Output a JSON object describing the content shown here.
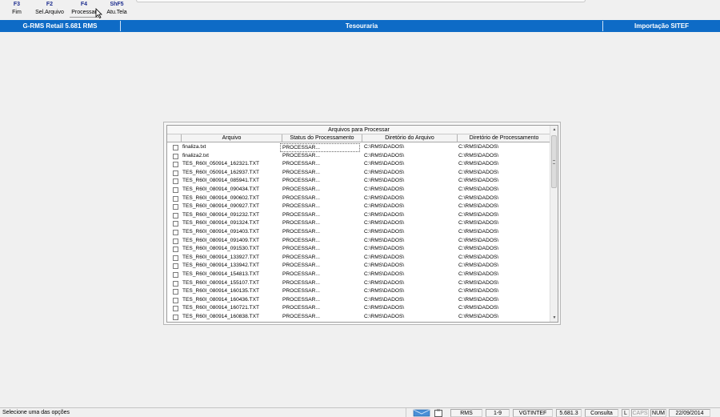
{
  "function_keys": [
    {
      "key": "F3",
      "label": "Fim"
    },
    {
      "key": "F2",
      "label": "Sel.Arquivo"
    },
    {
      "key": "F4",
      "label": "Processar"
    },
    {
      "key": "ShF5",
      "label": "Atu.Tela"
    }
  ],
  "title_bar": {
    "app": "G-RMS Retail 5.681 RMS",
    "module": "Tesouraria",
    "screen": "Importação SITEF",
    "color": "#0e6bc6"
  },
  "grid": {
    "title": "Arquivos para Processar",
    "columns": [
      "Arquivo",
      "Status do Processamento",
      "Diretório do Arquivo",
      "Diretório de Processamento"
    ],
    "rows": [
      {
        "file": "finaliza.txt",
        "status": "PROCESSAR...",
        "dir": "C:\\RMS\\DADOS\\",
        "proc_dir": "C:\\RMS\\DADOS\\"
      },
      {
        "file": "finaliza2.txt",
        "status": "PROCESSAR...",
        "dir": "C:\\RMS\\DADOS\\",
        "proc_dir": "C:\\RMS\\DADOS\\"
      },
      {
        "file": "TES_R60I_050914_162321.TXT",
        "status": "PROCESSAR...",
        "dir": "C:\\RMS\\DADOS\\",
        "proc_dir": "C:\\RMS\\DADOS\\"
      },
      {
        "file": "TES_R60I_050914_162937.TXT",
        "status": "PROCESSAR...",
        "dir": "C:\\RMS\\DADOS\\",
        "proc_dir": "C:\\RMS\\DADOS\\"
      },
      {
        "file": "TES_R60I_080914_085941.TXT",
        "status": "PROCESSAR...",
        "dir": "C:\\RMS\\DADOS\\",
        "proc_dir": "C:\\RMS\\DADOS\\"
      },
      {
        "file": "TES_R60I_080914_090434.TXT",
        "status": "PROCESSAR...",
        "dir": "C:\\RMS\\DADOS\\",
        "proc_dir": "C:\\RMS\\DADOS\\"
      },
      {
        "file": "TES_R60I_080914_090602.TXT",
        "status": "PROCESSAR...",
        "dir": "C:\\RMS\\DADOS\\",
        "proc_dir": "C:\\RMS\\DADOS\\"
      },
      {
        "file": "TES_R60I_080914_090927.TXT",
        "status": "PROCESSAR...",
        "dir": "C:\\RMS\\DADOS\\",
        "proc_dir": "C:\\RMS\\DADOS\\"
      },
      {
        "file": "TES_R60I_080914_091232.TXT",
        "status": "PROCESSAR...",
        "dir": "C:\\RMS\\DADOS\\",
        "proc_dir": "C:\\RMS\\DADOS\\"
      },
      {
        "file": "TES_R60I_080914_091324.TXT",
        "status": "PROCESSAR...",
        "dir": "C:\\RMS\\DADOS\\",
        "proc_dir": "C:\\RMS\\DADOS\\"
      },
      {
        "file": "TES_R60I_080914_091403.TXT",
        "status": "PROCESSAR...",
        "dir": "C:\\RMS\\DADOS\\",
        "proc_dir": "C:\\RMS\\DADOS\\"
      },
      {
        "file": "TES_R60I_080914_091409.TXT",
        "status": "PROCESSAR...",
        "dir": "C:\\RMS\\DADOS\\",
        "proc_dir": "C:\\RMS\\DADOS\\"
      },
      {
        "file": "TES_R60I_080914_091530.TXT",
        "status": "PROCESSAR...",
        "dir": "C:\\RMS\\DADOS\\",
        "proc_dir": "C:\\RMS\\DADOS\\"
      },
      {
        "file": "TES_R60I_080914_133927.TXT",
        "status": "PROCESSAR...",
        "dir": "C:\\RMS\\DADOS\\",
        "proc_dir": "C:\\RMS\\DADOS\\"
      },
      {
        "file": "TES_R60I_080914_133942.TXT",
        "status": "PROCESSAR...",
        "dir": "C:\\RMS\\DADOS\\",
        "proc_dir": "C:\\RMS\\DADOS\\"
      },
      {
        "file": "TES_R60I_080914_154813.TXT",
        "status": "PROCESSAR...",
        "dir": "C:\\RMS\\DADOS\\",
        "proc_dir": "C:\\RMS\\DADOS\\"
      },
      {
        "file": "TES_R60I_080914_155107.TXT",
        "status": "PROCESSAR...",
        "dir": "C:\\RMS\\DADOS\\",
        "proc_dir": "C:\\RMS\\DADOS\\"
      },
      {
        "file": "TES_R60I_080914_160135.TXT",
        "status": "PROCESSAR...",
        "dir": "C:\\RMS\\DADOS\\",
        "proc_dir": "C:\\RMS\\DADOS\\"
      },
      {
        "file": "TES_R60I_080914_160436.TXT",
        "status": "PROCESSAR...",
        "dir": "C:\\RMS\\DADOS\\",
        "proc_dir": "C:\\RMS\\DADOS\\"
      },
      {
        "file": "TES_R60I_080914_160721.TXT",
        "status": "PROCESSAR...",
        "dir": "C:\\RMS\\DADOS\\",
        "proc_dir": "C:\\RMS\\DADOS\\"
      },
      {
        "file": "TES_R60I_080914_160838.TXT",
        "status": "PROCESSAR...",
        "dir": "C:\\RMS\\DADOS\\",
        "proc_dir": "C:\\RMS\\DADOS\\"
      }
    ]
  },
  "status_bar": {
    "message": "Selecione uma das opções",
    "system": "RMS",
    "range": "1-9",
    "connection": "VGTINTEF",
    "version": "5.681.3",
    "mode": "Consulta",
    "l_indicator": "L",
    "caps": "CAPS",
    "num": "NUM",
    "date": "22/09/2014"
  },
  "icons": {
    "scroll_up": "scroll-up-icon",
    "scroll_down": "scroll-down-icon",
    "envelope": "network-envelope-icon",
    "clipboard": "clipboard-icon",
    "cursor": "mouse-pointer-icon"
  }
}
